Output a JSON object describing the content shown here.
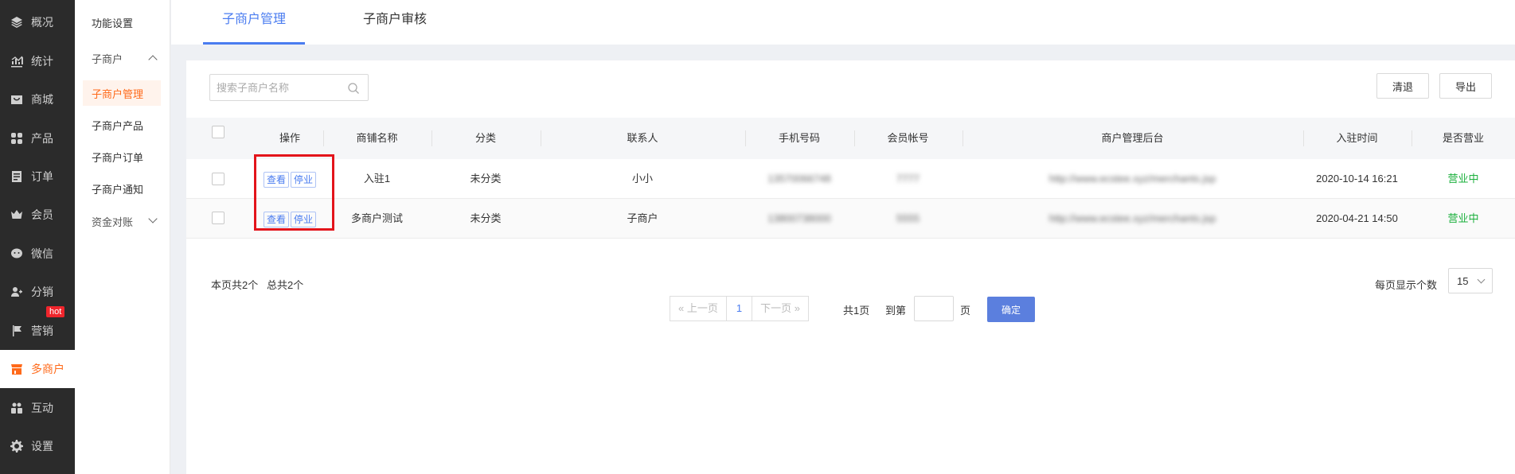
{
  "nav": {
    "items": [
      {
        "label": "概况",
        "icon": "layers-icon"
      },
      {
        "label": "统计",
        "icon": "chart-icon"
      },
      {
        "label": "商城",
        "icon": "mall-icon"
      },
      {
        "label": "产品",
        "icon": "grid-icon"
      },
      {
        "label": "订单",
        "icon": "order-icon"
      },
      {
        "label": "会员",
        "icon": "crown-icon"
      },
      {
        "label": "微信",
        "icon": "wechat-icon"
      },
      {
        "label": "分销",
        "icon": "user-share-icon"
      },
      {
        "label": "营销",
        "icon": "flag-icon"
      },
      {
        "label": "多商户",
        "icon": "shop-icon"
      },
      {
        "label": "互动",
        "icon": "interact-icon"
      },
      {
        "label": "设置",
        "icon": "gear-icon"
      }
    ],
    "hot_badge": "hot",
    "active_color": "#ff6a1a"
  },
  "subnav": {
    "feature_settings": "功能设置",
    "group_submerchant": "子商户",
    "items": [
      "子商户管理",
      "子商户产品",
      "子商户订单",
      "子商户通知"
    ],
    "group_funds": "资金对账"
  },
  "tabs": [
    "子商户管理",
    "子商户审核"
  ],
  "search": {
    "placeholder": "搜索子商户名称"
  },
  "toolbar": {
    "clear_label": "清退",
    "export_label": "导出"
  },
  "table": {
    "headers": [
      "操作",
      "商铺名称",
      "分类",
      "联系人",
      "手机号码",
      "会员帐号",
      "商户管理后台",
      "入驻时间",
      "是否营业"
    ],
    "op_view": "查看",
    "op_stop": "停业",
    "rows": [
      {
        "name": "入驻1",
        "category": "未分类",
        "contact": "小小",
        "phone": "13570066748",
        "account": "7777",
        "admin_url": "http://www.ecstee.xyz/merchants.jsp",
        "joined": "2020-10-14 16:21",
        "status": "营业中"
      },
      {
        "name": "多商户测试",
        "category": "未分类",
        "contact": "子商户",
        "phone": "13800738000",
        "account": "5555",
        "admin_url": "http://www.ecstee.xyz/merchants.jsp",
        "joined": "2020-04-21 14:50",
        "status": "营业中"
      }
    ]
  },
  "footer": {
    "page_count_text": "本页共2个",
    "total_text": "总共2个",
    "prev": "上一页",
    "current_page": "1",
    "next": "下一页",
    "total_pages": "共1页",
    "goto_label": "到第",
    "page_unit": "页",
    "confirm": "确定",
    "per_page_label": "每页显示个数",
    "per_page_value": "15"
  }
}
